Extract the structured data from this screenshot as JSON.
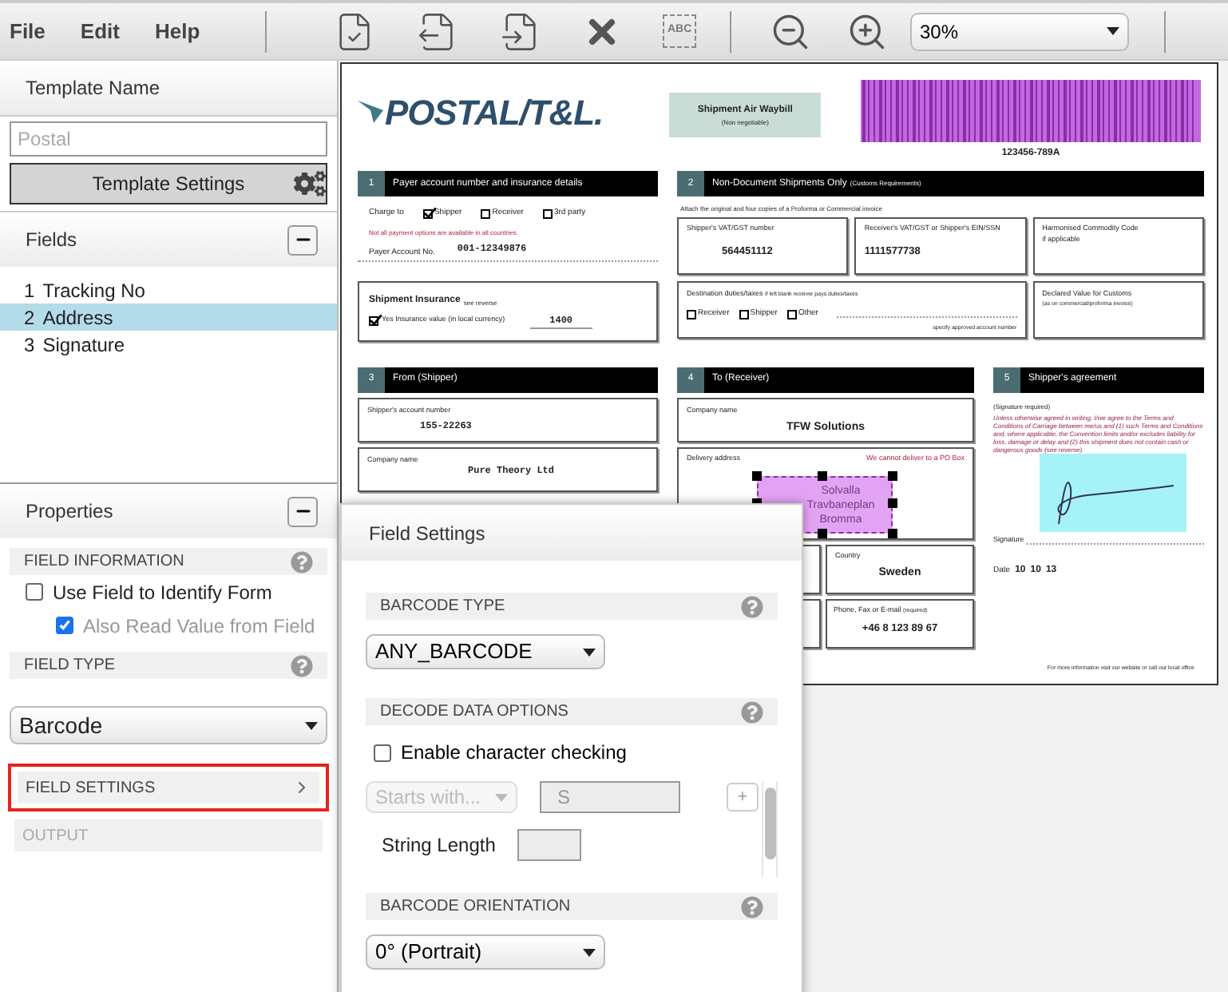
{
  "menu": [
    "File",
    "Edit",
    "Help"
  ],
  "toolbar": [
    {
      "kind": "validate"
    },
    {
      "kind": "export"
    },
    {
      "kind": "import"
    },
    {
      "kind": "delete"
    },
    {
      "kind": "text",
      "label": "ABC"
    }
  ],
  "zoom_tools": [
    {
      "kind": "zoom-out"
    },
    {
      "kind": "zoom-in"
    }
  ],
  "zoom": {
    "value": "30%"
  },
  "template": {
    "title": "Template Name",
    "placeholder": "Postal",
    "button": "Template Settings"
  },
  "fields": {
    "title": "Fields",
    "items": [
      {
        "number": "1",
        "name": "Tracking No",
        "selected": false
      },
      {
        "number": "2",
        "name": "Address",
        "selected": true
      },
      {
        "number": "3",
        "name": "Signature",
        "selected": false
      }
    ]
  },
  "properties": {
    "title": "Properties",
    "sections": [
      {
        "kind": "header",
        "label": "FIELD INFORMATION",
        "help": true
      },
      {
        "kind": "checkbox",
        "label": "Use Field to Identify Form",
        "checked": false,
        "disabled": false,
        "children": [
          {
            "label": "Also Read Value from Field",
            "checked": true,
            "disabled": true
          }
        ]
      },
      {
        "kind": "header",
        "label": "FIELD TYPE",
        "help": true
      },
      {
        "kind": "select",
        "value": "Barcode"
      },
      {
        "kind": "link",
        "label": "FIELD SETTINGS",
        "highlighted": true,
        "disabled": false
      },
      {
        "kind": "link",
        "label": "OUTPUT",
        "highlighted": false,
        "disabled": true
      }
    ]
  },
  "document": {
    "logo": "POSTAL/T&L.",
    "waybill": {
      "title": "Shipment Air Waybill",
      "subtitle": "(Non negotiable)"
    },
    "barcode_number": "123456-789A",
    "section1": {
      "number": "1",
      "title": "Payer account number and insurance details",
      "charge_label": "Charge to",
      "options": [
        {
          "label": "Shipper",
          "checked": true
        },
        {
          "label": "Receiver",
          "checked": false
        },
        {
          "label": "3rd party",
          "checked": false
        }
      ],
      "note": "Not all payment options are available in all countries.",
      "account_label": "Payer Account No.",
      "account_value": "001-12349876",
      "insurance_title": "Shipment Insurance",
      "insurance_note": "see reverse",
      "insurance_option": {
        "label": "Yes Insurance value (in local currency)",
        "checked": true
      },
      "insurance_value": "1400"
    },
    "section2": {
      "number": "2",
      "title": "Non-Document Shipments Only",
      "title_note": "(Customs Requirements)",
      "instruction": "Attach the original and four copies of a Proforma or Commercial invoice",
      "boxes": [
        {
          "label": "Shipper's VAT/GST number",
          "value": "564451112"
        },
        {
          "label": "Receiver's VAT/GST or Shipper's EIN/SSN",
          "value": "1111577738"
        },
        {
          "label": "Harmonised Commodity Code",
          "value": "if applicable"
        }
      ],
      "duties": {
        "label": "Destination duties/taxes",
        "note": "if left blank receiver pays duties/taxes",
        "options": [
          {
            "label": "Receiver",
            "checked": false
          },
          {
            "label": "Shipper",
            "checked": false
          },
          {
            "label": "Other",
            "checked": false
          }
        ],
        "hint": "specify approved account number"
      },
      "declared": {
        "label": "Declared Value for Customs",
        "note": "(as on commercial/proforma invoice)"
      }
    },
    "section3": {
      "number": "3",
      "title": "From (Shipper)",
      "boxes": [
        {
          "label": "Shipper's account number",
          "value": "155-22263"
        },
        {
          "label": "Company name",
          "value": "Pure Theory Ltd"
        }
      ]
    },
    "section4": {
      "number": "4",
      "title": "To (Receiver)",
      "company": {
        "label": "Company name",
        "value": "TFW Solutions"
      },
      "delivery": {
        "label": "Delivery address",
        "note": "We cannot deliver to a PO Box",
        "lines": [
          "Solvalla",
          "Travbaneplan",
          "Bromma"
        ]
      },
      "country": {
        "label": "Country",
        "value": "Sweden"
      },
      "phone": {
        "label": "Phone, Fax or E-mail",
        "note": "(required)",
        "value": "+46 8 123 89 67"
      }
    },
    "section5": {
      "number": "5",
      "title": "Shipper's agreement",
      "required": "(Signature required)",
      "terms": "Unless otherwise agreed in writing, I/we agree to the Terms and Conditions of Carriage between me/us and (1) such Terms and Conditions and, where applicable, the Convention limits and/or excludes liability for loss, damage or delay and (2) this shipment does not contain cash or dangerous goods (see reverse).",
      "signature_label": "Signature",
      "date_label": "Date",
      "date": [
        "10",
        "10",
        "13"
      ]
    },
    "footer": "For more information visit our website or call our local office"
  },
  "field_settings": {
    "title": "Field Settings",
    "barcode_type": {
      "label": "BARCODE TYPE",
      "value": "ANY_BARCODE"
    },
    "decode": {
      "label": "DECODE DATA OPTIONS",
      "checkbox": {
        "label": "Enable character checking",
        "checked": false
      },
      "condition": "Starts with...",
      "condition_value": "S",
      "add": "+",
      "length_label": "String Length"
    },
    "orientation": {
      "label": "BARCODE ORIENTATION",
      "value": "0° (Portrait)"
    }
  }
}
